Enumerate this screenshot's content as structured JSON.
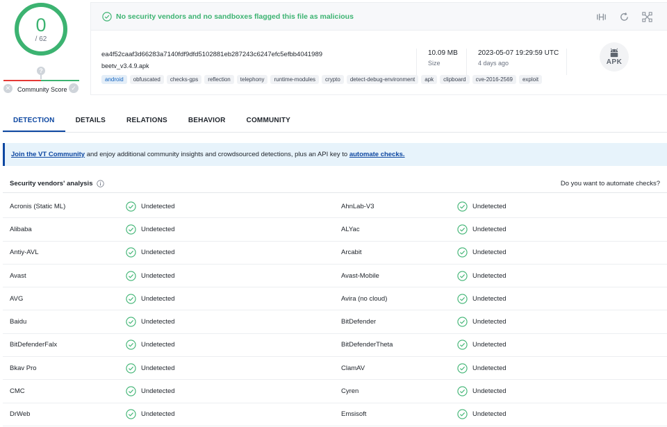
{
  "score": {
    "value": "0",
    "total": "/ 62",
    "community_label": "Community Score"
  },
  "banner": {
    "message": "No security vendors and no sandboxes flagged this file as malicious"
  },
  "file": {
    "hash": "ea4f52caaf3d66283a7140fdf9dfd5102881eb287243c6247efc5efbb4041989",
    "name": "beetv_v3.4.9.apk",
    "size_value": "10.09 MB",
    "size_label": "Size",
    "date_value": "2023-05-07 19:29:59 UTC",
    "date_label": "4 days ago",
    "type_badge": "APK",
    "tags": [
      "android",
      "obfuscated",
      "checks-gps",
      "reflection",
      "telephony",
      "runtime-modules",
      "crypto",
      "detect-debug-environment",
      "apk",
      "clipboard",
      "cve-2016-2569",
      "exploit"
    ]
  },
  "tabs": [
    "DETECTION",
    "DETAILS",
    "RELATIONS",
    "BEHAVIOR",
    "COMMUNITY"
  ],
  "join": {
    "link1": "Join the VT Community",
    "middle": " and enjoy additional community insights and crowdsourced detections, plus an API key to ",
    "link2": "automate checks."
  },
  "vendors": {
    "title": "Security vendors' analysis",
    "automate_prompt": "Do you want to automate checks?",
    "rows": [
      [
        "Acronis (Static ML)",
        "Undetected",
        "AhnLab-V3",
        "Undetected"
      ],
      [
        "Alibaba",
        "Undetected",
        "ALYac",
        "Undetected"
      ],
      [
        "Antiy-AVL",
        "Undetected",
        "Arcabit",
        "Undetected"
      ],
      [
        "Avast",
        "Undetected",
        "Avast-Mobile",
        "Undetected"
      ],
      [
        "AVG",
        "Undetected",
        "Avira (no cloud)",
        "Undetected"
      ],
      [
        "Baidu",
        "Undetected",
        "BitDefender",
        "Undetected"
      ],
      [
        "BitDefenderFalx",
        "Undetected",
        "BitDefenderTheta",
        "Undetected"
      ],
      [
        "Bkav Pro",
        "Undetected",
        "ClamAV",
        "Undetected"
      ],
      [
        "CMC",
        "Undetected",
        "Cyren",
        "Undetected"
      ],
      [
        "DrWeb",
        "Undetected",
        "Emsisoft",
        "Undetected"
      ]
    ]
  },
  "colors": {
    "accent": "#0d47a1",
    "clean": "#3cb371",
    "malicious": "#e53935"
  },
  "icons": [
    "check-circle-icon",
    "compare-icon",
    "reanalyze-icon",
    "graph-icon",
    "android-icon",
    "info-icon",
    "question-icon",
    "close-icon",
    "check-icon"
  ]
}
